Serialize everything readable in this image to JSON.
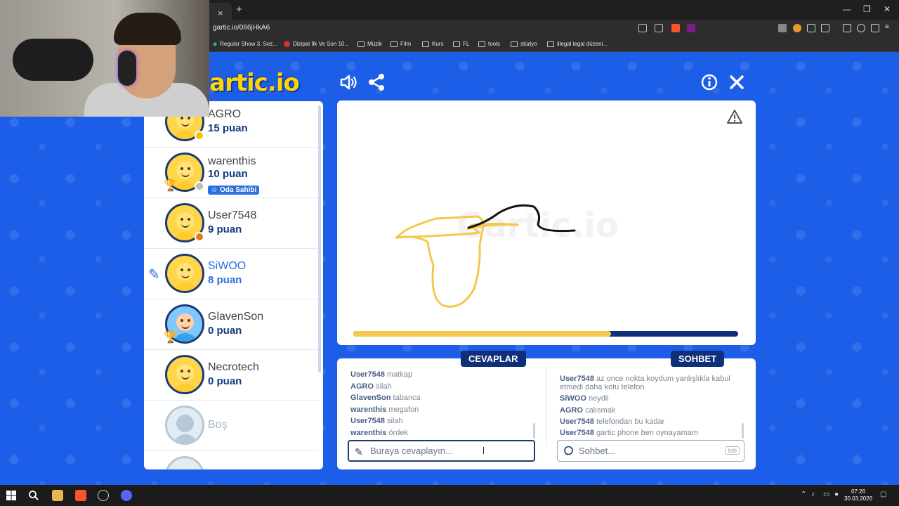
{
  "browser": {
    "url": "gartic.io/066jHkA6",
    "tab_close": "×",
    "new_tab": "+",
    "bookmarks": [
      {
        "label": "Regular Show 3. Sez...",
        "icon": "video-icon"
      },
      {
        "label": "Dizipal İlk Ve Son 10...",
        "icon": "site-icon"
      },
      {
        "label": "Müzik",
        "icon": "folder-icon"
      },
      {
        "label": "Film",
        "icon": "folder-icon"
      },
      {
        "label": "Kurs",
        "icon": "folder-icon"
      },
      {
        "label": "FL",
        "icon": "folder-icon"
      },
      {
        "label": "tools",
        "icon": "folder-icon"
      },
      {
        "label": "stüdyo",
        "icon": "folder-icon"
      },
      {
        "label": "illegal legal düzeni...",
        "icon": "folder-icon"
      }
    ]
  },
  "game": {
    "logo": "artic.io",
    "watermark": "Gartic.io",
    "players": [
      {
        "name": "AGRO",
        "score": "15 puan",
        "status_color": "#f2c400"
      },
      {
        "name": "warenthis",
        "score": "10 puan",
        "badge": "Oda Sahibi",
        "status_color": "#bdbdbd"
      },
      {
        "name": "User7548",
        "score": "9 puan",
        "status_color": "#e07a10"
      },
      {
        "name": "SiWOO",
        "score": "8 puan"
      },
      {
        "name": "GlavenSon",
        "score": "0 puan"
      },
      {
        "name": "Necrotech",
        "score": "0 puan"
      },
      {
        "name": "Boş"
      }
    ],
    "timer_progress": 0.67,
    "answers_tab": "CEVAPLAR",
    "chat_tab": "SOHBET",
    "answers": [
      {
        "user": "User7548",
        "text": "matkap"
      },
      {
        "user": "AGRO",
        "text": "silah"
      },
      {
        "user": "GlavenSon",
        "text": "tabanca"
      },
      {
        "user": "warenthis",
        "text": "megafon"
      },
      {
        "user": "User7548",
        "text": "silah"
      },
      {
        "user": "warenthis",
        "text": "ördek"
      }
    ],
    "chat": [
      {
        "user": "User7548",
        "text": "az once nokta koydum yanlışlıkla kabul etmedi daha kotu telefon"
      },
      {
        "user": "SiWOO",
        "text": "neydii"
      },
      {
        "user": "AGRO",
        "text": "calısmak"
      },
      {
        "user": "User7548",
        "text": "telefondan bu kadar"
      },
      {
        "user": "User7548",
        "text": "gartic phone ben oynayamam"
      }
    ],
    "answer_placeholder": "Buraya cevaplayın...",
    "chat_placeholder": "Sohbet...",
    "tab_key": "tab"
  },
  "taskbar": {
    "time": "07:26",
    "date": "30.03.2026"
  },
  "colors": {
    "page_bg": "#1d5ee8",
    "navy": "#0f2f7a",
    "accent_blue": "#2a6fe0",
    "yellow": "#f2c94c"
  }
}
